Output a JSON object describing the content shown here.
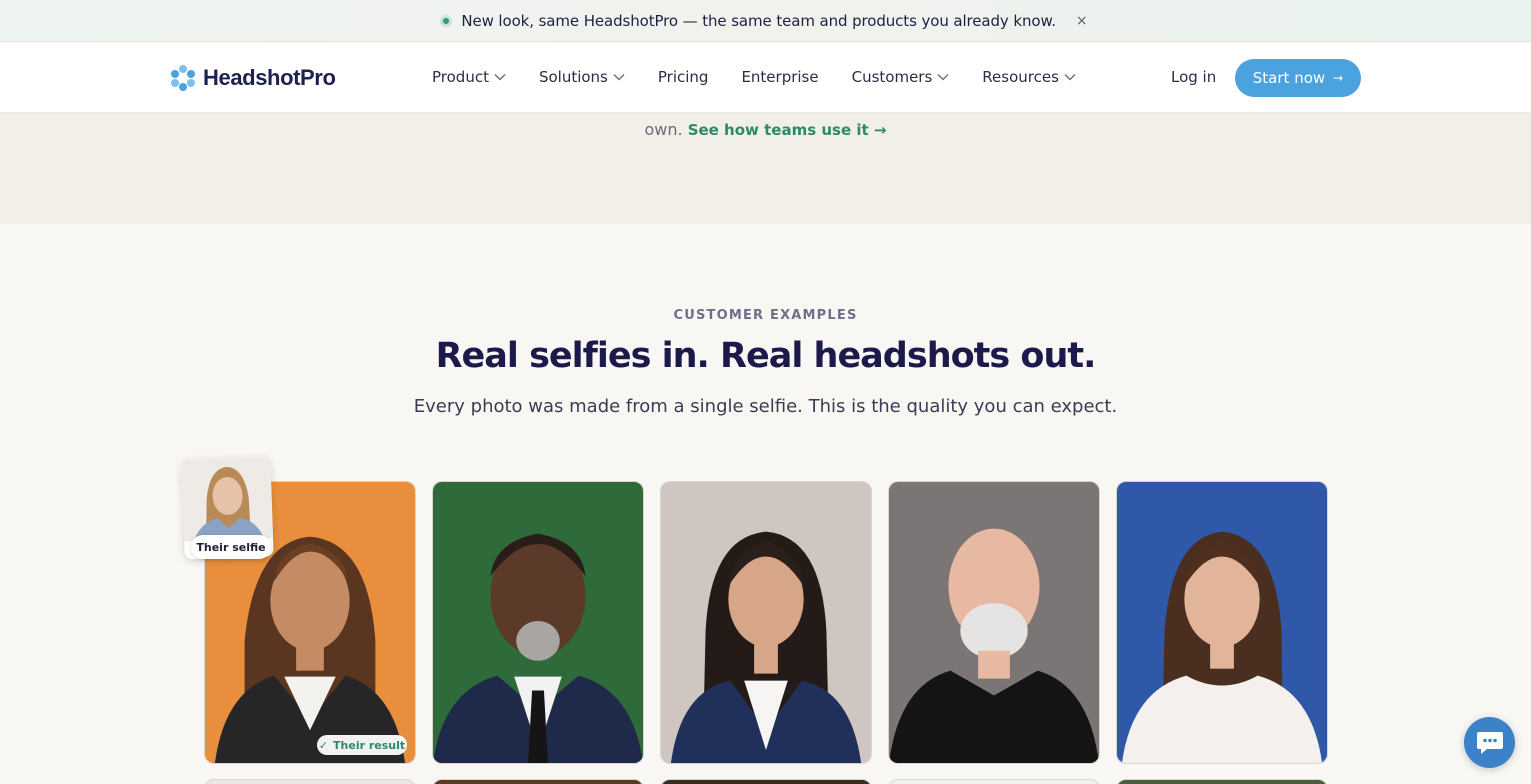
{
  "announcement": {
    "text": "New look, same HeadshotPro — the same team and products you already know.",
    "close_glyph": "×"
  },
  "nav": {
    "brand": "HeadshotPro",
    "items": [
      {
        "label": "Product",
        "has_dropdown": true
      },
      {
        "label": "Solutions",
        "has_dropdown": true
      },
      {
        "label": "Pricing",
        "has_dropdown": false
      },
      {
        "label": "Enterprise",
        "has_dropdown": false
      },
      {
        "label": "Customers",
        "has_dropdown": true
      },
      {
        "label": "Resources",
        "has_dropdown": true
      }
    ],
    "login": "Log in",
    "cta": "Start now",
    "cta_arrow": "→"
  },
  "hero": {
    "tail_text": "own.",
    "link": "See how teams use it",
    "link_arrow": "→"
  },
  "examples": {
    "eyebrow": "CUSTOMER EXAMPLES",
    "title": "Real selfies in. Real headshots out.",
    "subtitle": "Every photo was made from a single selfie. This is the quality you can expect.",
    "selfie_label": "Their selfie",
    "result_label": "Their result",
    "result_check": "✓"
  },
  "colors": {
    "brand": "#1e2150",
    "accent": "#4aa3df",
    "link_green": "#2c8a68",
    "chat": "#3b82c8"
  },
  "icons": {
    "close": "close-icon",
    "chevron": "chevron-down-icon",
    "chat": "chat-bubble-icon",
    "logo": "headshotpro-logo-icon"
  }
}
